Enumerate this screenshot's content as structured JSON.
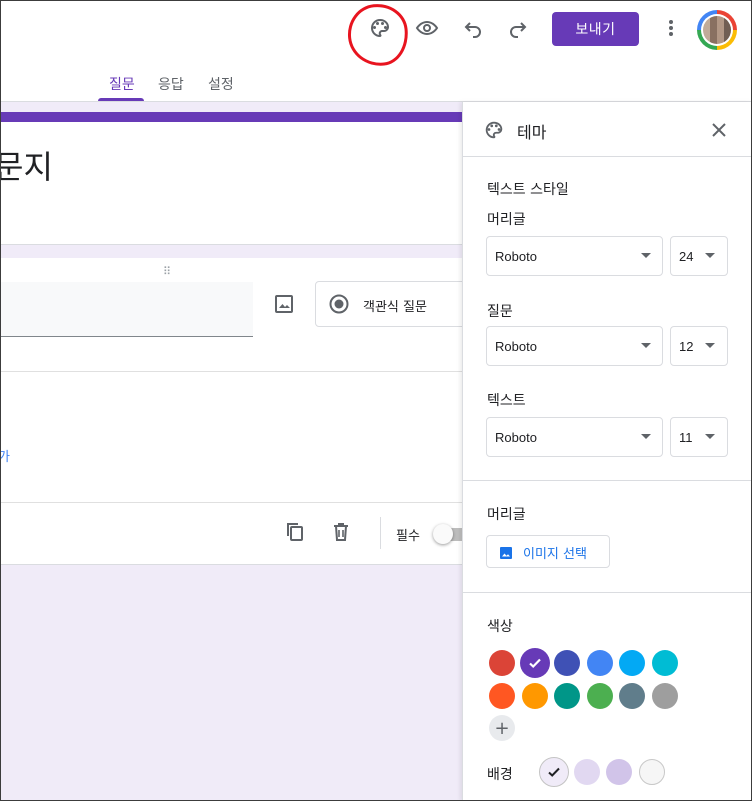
{
  "toolbar": {
    "send_label": "보내기",
    "icons": [
      "palette-icon",
      "eye-icon",
      "undo-icon",
      "redo-icon",
      "more-vert-icon"
    ]
  },
  "tabs": [
    {
      "label": "질문",
      "active": true
    },
    {
      "label": "응답",
      "active": false
    },
    {
      "label": "설정",
      "active": false
    }
  ],
  "form": {
    "title_fragment": "문지",
    "accent_color": "#673ab7",
    "background_color": "#f0ebf8"
  },
  "question": {
    "type_label": "객관식 질문",
    "add_option_fragment": "가",
    "required_label": "필수",
    "required_on": false
  },
  "theme_panel": {
    "title": "테마",
    "text_style": {
      "section_label": "텍스트 스타일",
      "header": {
        "label": "머리글",
        "font": "Roboto",
        "size": "24"
      },
      "question": {
        "label": "질문",
        "font": "Roboto",
        "size": "12"
      },
      "text": {
        "label": "텍스트",
        "font": "Roboto",
        "size": "11"
      }
    },
    "header_image": {
      "section_label": "머리글",
      "button_label": "이미지 선택"
    },
    "color": {
      "section_label": "색상",
      "swatches": [
        {
          "color": "#db4437",
          "selected": false
        },
        {
          "color": "#673ab7",
          "selected": true
        },
        {
          "color": "#3f51b5",
          "selected": false
        },
        {
          "color": "#4285f4",
          "selected": false
        },
        {
          "color": "#03a9f4",
          "selected": false
        },
        {
          "color": "#00bcd4",
          "selected": false
        },
        {
          "color": "#ff5722",
          "selected": false
        },
        {
          "color": "#ff9800",
          "selected": false
        },
        {
          "color": "#009688",
          "selected": false
        },
        {
          "color": "#4caf50",
          "selected": false
        },
        {
          "color": "#607d8b",
          "selected": false
        },
        {
          "color": "#9e9e9e",
          "selected": false
        }
      ],
      "add_label": "+"
    },
    "background": {
      "section_label": "배경",
      "swatches": [
        {
          "color": "#f0ebf8",
          "selected": true
        },
        {
          "color": "#e1d8f1",
          "selected": false
        },
        {
          "color": "#d1c4e9",
          "selected": false
        },
        {
          "color": "#f6f6f6",
          "selected": false
        }
      ]
    }
  }
}
